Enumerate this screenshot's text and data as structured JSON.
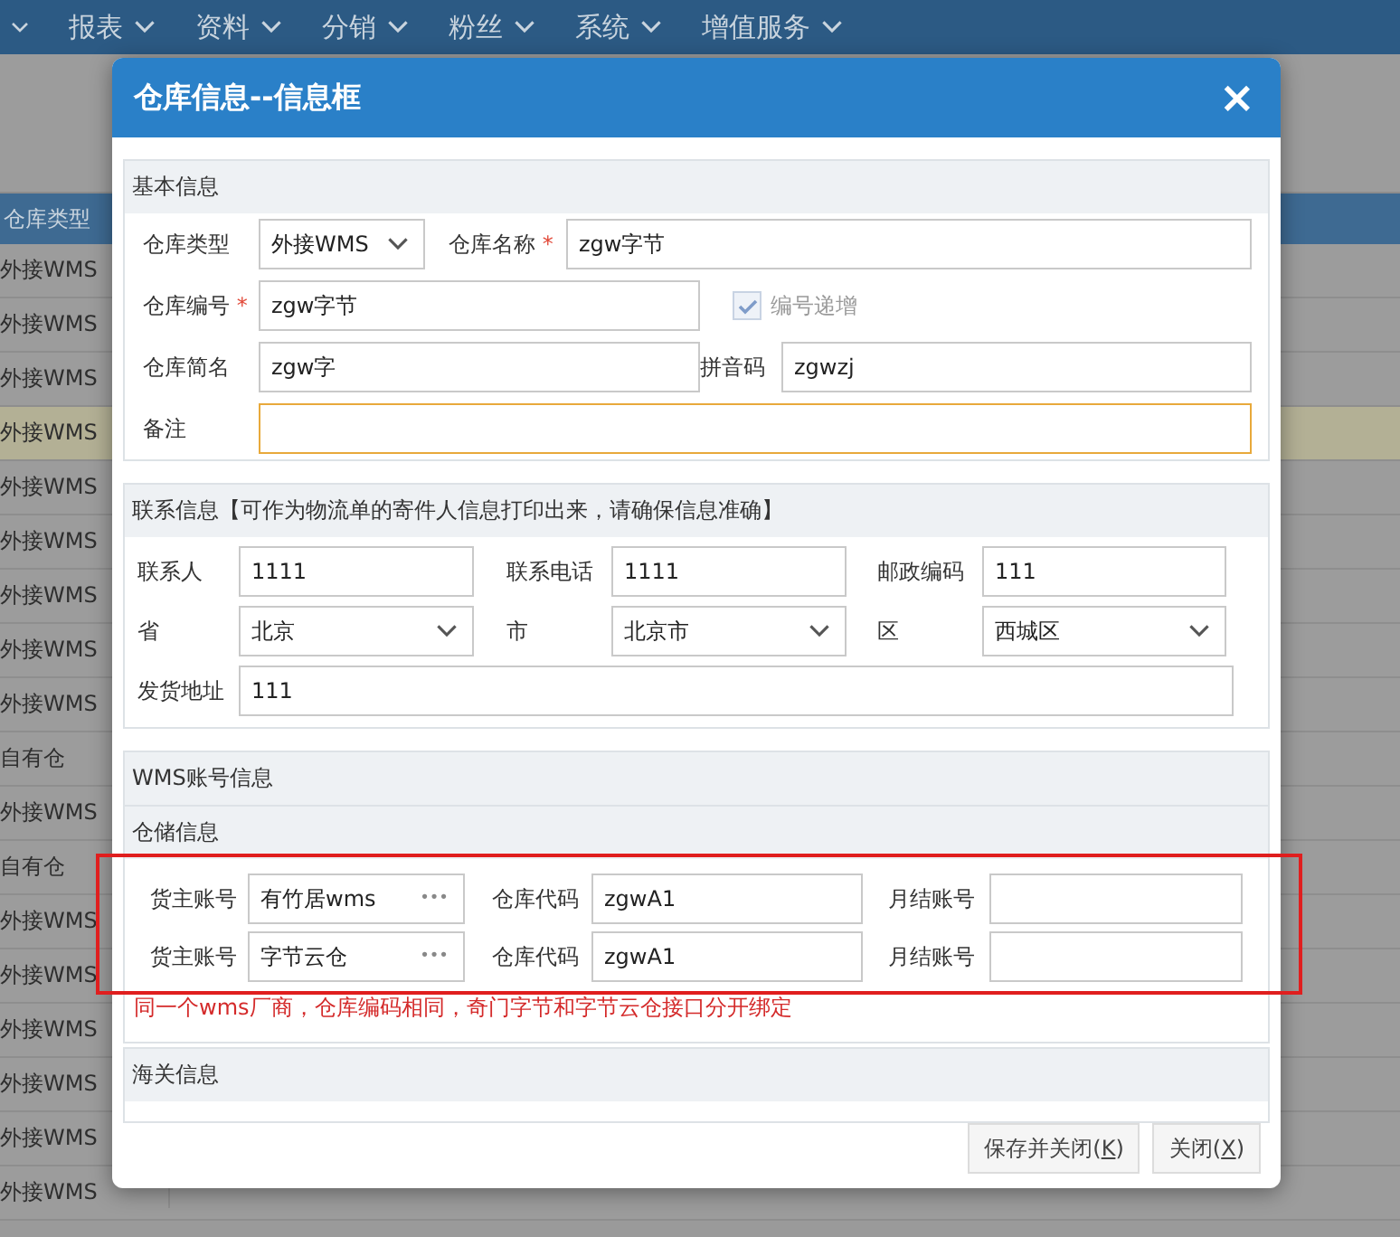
{
  "nav": {
    "items": [
      "报表",
      "资料",
      "分销",
      "粉丝",
      "系统",
      "增值服务"
    ]
  },
  "table": {
    "columns": [
      "仓库类型"
    ],
    "rows": [
      {
        "cell": "外接WMS",
        "selected": false
      },
      {
        "cell": "外接WMS",
        "selected": false
      },
      {
        "cell": "外接WMS",
        "selected": false
      },
      {
        "cell": "外接WMS",
        "selected": true
      },
      {
        "cell": "外接WMS",
        "selected": false
      },
      {
        "cell": "外接WMS",
        "selected": false
      },
      {
        "cell": "外接WMS",
        "selected": false
      },
      {
        "cell": "外接WMS",
        "selected": false
      },
      {
        "cell": "外接WMS",
        "selected": false
      },
      {
        "cell": "自有仓",
        "selected": false
      },
      {
        "cell": "外接WMS",
        "selected": false
      },
      {
        "cell": "自有仓",
        "selected": false
      },
      {
        "cell": "外接WMS",
        "selected": false
      },
      {
        "cell": "外接WMS",
        "selected": false
      },
      {
        "cell": "外接WMS",
        "selected": false
      },
      {
        "cell": "外接WMS",
        "selected": false
      },
      {
        "cell": "外接WMS",
        "selected": false
      },
      {
        "cell": "外接WMS",
        "selected": false
      }
    ]
  },
  "dialog": {
    "title": "仓库信息--信息框",
    "close": "×",
    "basic": {
      "title": "基本信息",
      "rows": [
        [
          {
            "kind": "select",
            "label": "仓库类型",
            "value": "外接WMS"
          },
          {
            "kind": "input",
            "label": "仓库名称",
            "value": "zgw字节",
            "required_mark": "*"
          }
        ],
        [
          {
            "kind": "input",
            "label": "仓库编号",
            "value": "zgw字节",
            "required_mark": "*"
          },
          {
            "kind": "checkbox",
            "label": "编号递增",
            "checked": true,
            "disabled": true
          }
        ],
        [
          {
            "kind": "input",
            "label": "仓库简名",
            "value": "zgw字"
          },
          {
            "kind": "input",
            "label": "拼音码",
            "value": "zgwzj"
          }
        ],
        [
          {
            "kind": "textarea",
            "label": "备注",
            "focused": true
          }
        ]
      ]
    },
    "contact": {
      "title": "联系信息【可作为物流单的寄件人信息打印出来，请确保信息准确】",
      "fields": [
        {
          "kind": "input",
          "label": "联系人",
          "value": "1111"
        },
        {
          "kind": "input",
          "label": "联系电话",
          "value": "1111"
        },
        {
          "kind": "input",
          "label": "邮政编码",
          "value": "111"
        },
        {
          "kind": "select",
          "label": "省",
          "value": "北京"
        },
        {
          "kind": "select",
          "label": "市",
          "value": "北京市"
        },
        {
          "kind": "select",
          "label": "区",
          "value": "西城区"
        },
        {
          "kind": "wide",
          "label": "发货地址",
          "value": "111"
        }
      ]
    },
    "wms": {
      "title": "WMS账号信息",
      "subtitle": "仓储信息",
      "rows": [
        {
          "owner_label": "货主账号",
          "owner": "有竹居wms",
          "more": "•••",
          "code_label": "仓库代码",
          "code": "zgwA1",
          "monthly_label": "月结账号"
        },
        {
          "owner_label": "货主账号",
          "owner": "字节云仓",
          "more": "•••",
          "code_label": "仓库代码",
          "code": "zgwA1",
          "monthly_label": "月结账号"
        }
      ],
      "note": "同一个wms厂商，仓库编码相同，奇门字节和字节云仓接口分开绑定"
    },
    "customs": {
      "title": "海关信息"
    },
    "buttons": [
      {
        "prefix": "保存并关闭(",
        "hotkey": "K",
        "suffix": ")"
      },
      {
        "prefix": "关闭(",
        "hotkey": "X",
        "suffix": ")"
      }
    ]
  }
}
